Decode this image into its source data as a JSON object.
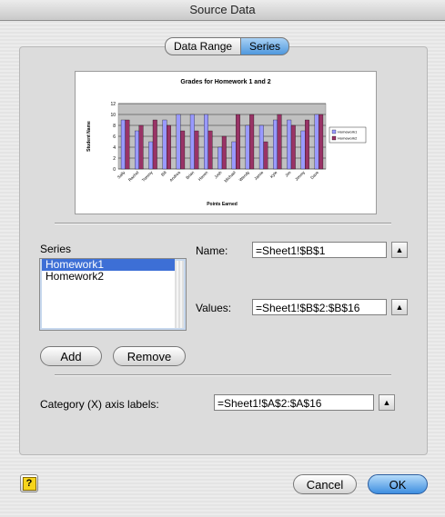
{
  "window": {
    "title": "Source Data"
  },
  "tabs": [
    {
      "label": "Data Range",
      "active": false
    },
    {
      "label": "Series",
      "active": true
    }
  ],
  "chart_data": {
    "type": "bar",
    "title": "Grades for Homework 1 and 2",
    "xlabel": "Points Earned",
    "ylabel": "Student Name",
    "ylim": [
      0,
      12
    ],
    "yticks": [
      0,
      2,
      4,
      6,
      8,
      10,
      12
    ],
    "categories": [
      "Sally",
      "Rachel",
      "Tommy",
      "Bill",
      "Andrea",
      "Brian",
      "Haven",
      "Josh",
      "Michael",
      "Wendy",
      "Jamie",
      "Kyle",
      "Jim",
      "Jimmy",
      "Dave"
    ],
    "series": [
      {
        "name": "Homework1",
        "color": "#9999ff",
        "values": [
          9,
          7,
          5,
          9,
          10,
          10,
          10,
          4,
          5,
          8,
          8,
          9,
          9,
          7,
          10
        ]
      },
      {
        "name": "Homework2",
        "color": "#993366",
        "values": [
          9,
          8,
          9,
          8,
          7,
          7,
          7,
          6,
          10,
          10,
          5,
          10,
          8,
          9,
          10
        ]
      }
    ],
    "legend": "right"
  },
  "series_section": {
    "label": "Series",
    "items": [
      "Homework1",
      "Homework2"
    ],
    "selected": "Homework1"
  },
  "name_field": {
    "label": "Name:",
    "value": "=Sheet1!$B$1"
  },
  "values_field": {
    "label": "Values:",
    "value": "=Sheet1!$B$2:$B$16"
  },
  "buttons": {
    "add": "Add",
    "remove": "Remove",
    "cancel": "Cancel",
    "ok": "OK"
  },
  "category_field": {
    "label": "Category (X) axis labels:",
    "value": "=Sheet1!$A$2:$A$16"
  },
  "help": {
    "glyph": "?"
  },
  "pick": {
    "glyph": "▲"
  }
}
